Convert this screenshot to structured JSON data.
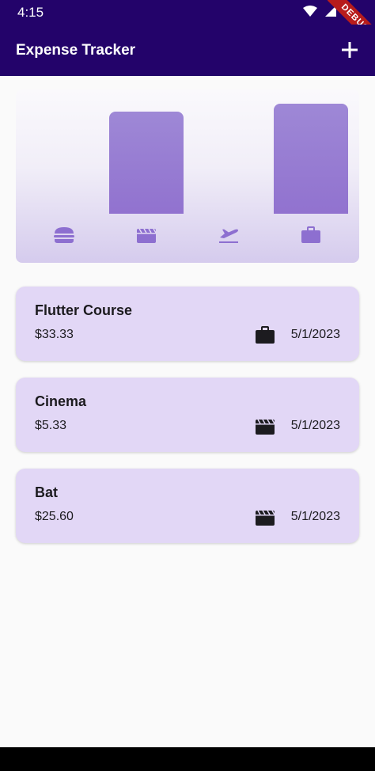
{
  "status_bar": {
    "time": "4:15"
  },
  "debug_banner": {
    "label": "DEBUG"
  },
  "app_bar": {
    "title": "Expense Tracker",
    "add_icon": "plus-icon"
  },
  "chart": {
    "categories": [
      {
        "icon": "food-icon",
        "value": 0
      },
      {
        "icon": "leisure-icon",
        "value": 0.93
      },
      {
        "icon": "travel-icon",
        "value": 0
      },
      {
        "icon": "work-icon",
        "value": 1.0
      }
    ]
  },
  "expenses": [
    {
      "title": "Flutter Course",
      "amount": "$33.33",
      "date": "5/1/2023",
      "icon": "work-icon"
    },
    {
      "title": "Cinema",
      "amount": "$5.33",
      "date": "5/1/2023",
      "icon": "leisure-icon"
    },
    {
      "title": "Bat",
      "amount": "$25.60",
      "date": "5/1/2023",
      "icon": "leisure-icon"
    }
  ],
  "colors": {
    "app_bar": "#23036a",
    "card": "#e2d7f6",
    "bar": "#9578d1",
    "chart_icon": "#8d6fd0"
  }
}
